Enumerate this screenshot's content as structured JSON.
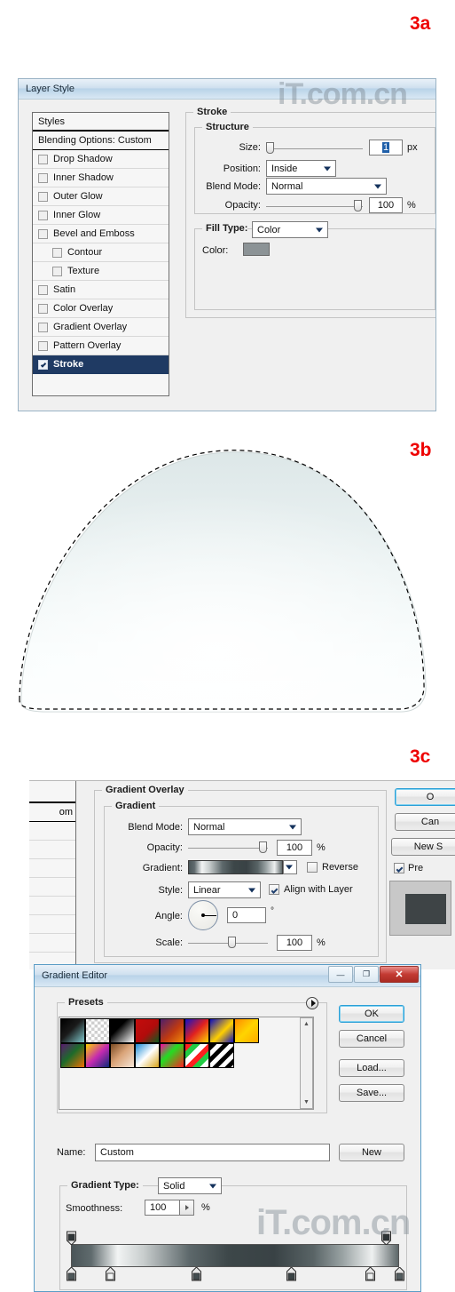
{
  "figure_labels": {
    "a": "3a",
    "b": "3b",
    "c": "3c"
  },
  "watermark": {
    "text": "iT.com.cn"
  },
  "layer_style_dialog": {
    "title": "Layer Style",
    "styles_panel": {
      "header": "Styles",
      "blending_options": "Blending Options: Custom",
      "items": [
        {
          "label": "Drop Shadow",
          "checked": false,
          "sub": false,
          "selected": false
        },
        {
          "label": "Inner Shadow",
          "checked": false,
          "sub": false,
          "selected": false
        },
        {
          "label": "Outer Glow",
          "checked": false,
          "sub": false,
          "selected": false
        },
        {
          "label": "Inner Glow",
          "checked": false,
          "sub": false,
          "selected": false
        },
        {
          "label": "Bevel and Emboss",
          "checked": false,
          "sub": false,
          "selected": false
        },
        {
          "label": "Contour",
          "checked": false,
          "sub": true,
          "selected": false
        },
        {
          "label": "Texture",
          "checked": false,
          "sub": true,
          "selected": false
        },
        {
          "label": "Satin",
          "checked": false,
          "sub": false,
          "selected": false
        },
        {
          "label": "Color Overlay",
          "checked": false,
          "sub": false,
          "selected": false
        },
        {
          "label": "Gradient Overlay",
          "checked": false,
          "sub": false,
          "selected": false
        },
        {
          "label": "Pattern Overlay",
          "checked": false,
          "sub": false,
          "selected": false
        },
        {
          "label": "Stroke",
          "checked": true,
          "sub": false,
          "selected": true
        }
      ]
    },
    "stroke": {
      "group_title": "Stroke",
      "structure_title": "Structure",
      "size_label": "Size:",
      "size_value": "1",
      "size_unit": "px",
      "size_slider_pct": 2,
      "position_label": "Position:",
      "position_value": "Inside",
      "blend_mode_label": "Blend Mode:",
      "blend_mode_value": "Normal",
      "opacity_label": "Opacity:",
      "opacity_value": "100",
      "opacity_unit": "%",
      "opacity_slider_pct": 100,
      "fill_type_label": "Fill Type:",
      "fill_type_value": "Color",
      "color_label": "Color:",
      "color_value": "#8c9396"
    }
  },
  "gradient_overlay_panel": {
    "group_title": "Gradient Overlay",
    "sub_group_title": "Gradient",
    "partial_list_text": "om",
    "blend_mode_label": "Blend Mode:",
    "blend_mode_value": "Normal",
    "opacity_label": "Opacity:",
    "opacity_value": "100",
    "opacity_unit": "%",
    "gradient_label": "Gradient:",
    "reverse_label": "Reverse",
    "reverse_checked": false,
    "style_label": "Style:",
    "style_value": "Linear",
    "align_with_layer_label": "Align with Layer",
    "align_with_layer_checked": true,
    "angle_label": "Angle:",
    "angle_value": "0",
    "angle_unit": "°",
    "scale_label": "Scale:",
    "scale_value": "100",
    "scale_unit": "%",
    "buttons": {
      "ok": "O",
      "cancel": "Can",
      "new_style": "New S",
      "preview_label": "Pre",
      "preview_checked": true
    }
  },
  "gradient_editor": {
    "title": "Gradient Editor",
    "window_buttons": {
      "minimize": "—",
      "maximize": "❐",
      "close": "✕"
    },
    "presets_title": "Presets",
    "preset_swatches": [
      "linear-gradient(135deg,#000000 0%,#1b1b1b 45%,#7fc9cd 100%)",
      "repeating-conic-gradient(#cfcfcf 0% 25%, #ffffff 0% 50%) 50% / 7px 7px",
      "linear-gradient(135deg,#000000 0%,#000000 35%,#ffffff 100%)",
      "linear-gradient(135deg,#c40d0d 0%,#b20b0b 55%,#0c5a1e 100%)",
      "linear-gradient(135deg,#4e1f6b 0%,#c03a10 55%,#f08a0a 100%)",
      "linear-gradient(135deg,#1212c8 0%,#e02020 50%,#ffd400 100%)",
      "linear-gradient(135deg,#0b0bc0 0%,#ffd000 55%,#1111b9 100%)",
      "linear-gradient(135deg,#ff8a00 0%,#ffd400 50%,#ffaa00 100%)",
      "linear-gradient(135deg,#5a1a6e 0%,#1d6b2a 45%,#f07000 100%)",
      "linear-gradient(135deg,#ffd400 0%,#c52ab0 50%,#0b2a7a 100%)",
      "linear-gradient(135deg,#7a4a22 0%,#d9a378 45%,#f6e6d8 100%)",
      "linear-gradient(135deg,#1b8bd6 0%,#ffffff 50%,#d9a316 100%)",
      "linear-gradient(135deg,#ff00a0 0%,#22dd22 40%,#ff2020 100%)",
      "repeating-linear-gradient(135deg,#ff2020 0 6px,#22cc44 6px 12px,#ffffff 12px 18px)",
      "repeating-linear-gradient(135deg,#000000 0 5px,#ffffff 5px 10px)"
    ],
    "name_label": "Name:",
    "name_value": "Custom",
    "new_button": "New",
    "gradient_type_label": "Gradient Type:",
    "gradient_type_value": "Solid",
    "smoothness_label": "Smoothness:",
    "smoothness_value": "100",
    "smoothness_unit": "%",
    "buttons": {
      "ok": "OK",
      "cancel": "Cancel",
      "load": "Load...",
      "save": "Save..."
    },
    "gradient_bar_css": "linear-gradient(to right,#4a5558 0%,#606b6e 6%,#f2f4f4 14%,#c8cdcd 22%,#5d686b 36%,#3d4749 48%,#394245 62%,#596466 74%,#9aa3a4 83%,#eef0f0 92%,#5d6769 100%)",
    "opacity_stops": [
      {
        "pos_pct": 0,
        "fill": "#2f3638"
      },
      {
        "pos_pct": 96,
        "fill": "#2f3638"
      }
    ],
    "color_stops": [
      {
        "pos_pct": 0,
        "fill": "#4e585b"
      },
      {
        "pos_pct": 12,
        "fill": "#f4f6f6"
      },
      {
        "pos_pct": 38,
        "fill": "#434d50"
      },
      {
        "pos_pct": 67,
        "fill": "#3a4345"
      },
      {
        "pos_pct": 91,
        "fill": "#eef0f0"
      },
      {
        "pos_pct": 100,
        "fill": "#545e61"
      }
    ]
  },
  "shape_3b": {
    "description": "dome-shaped selection with marching-ants dashed outline and pale cyan-white gradient fill",
    "fill_top": "#dfe8e8",
    "fill_bottom": "#fbfdfd"
  }
}
